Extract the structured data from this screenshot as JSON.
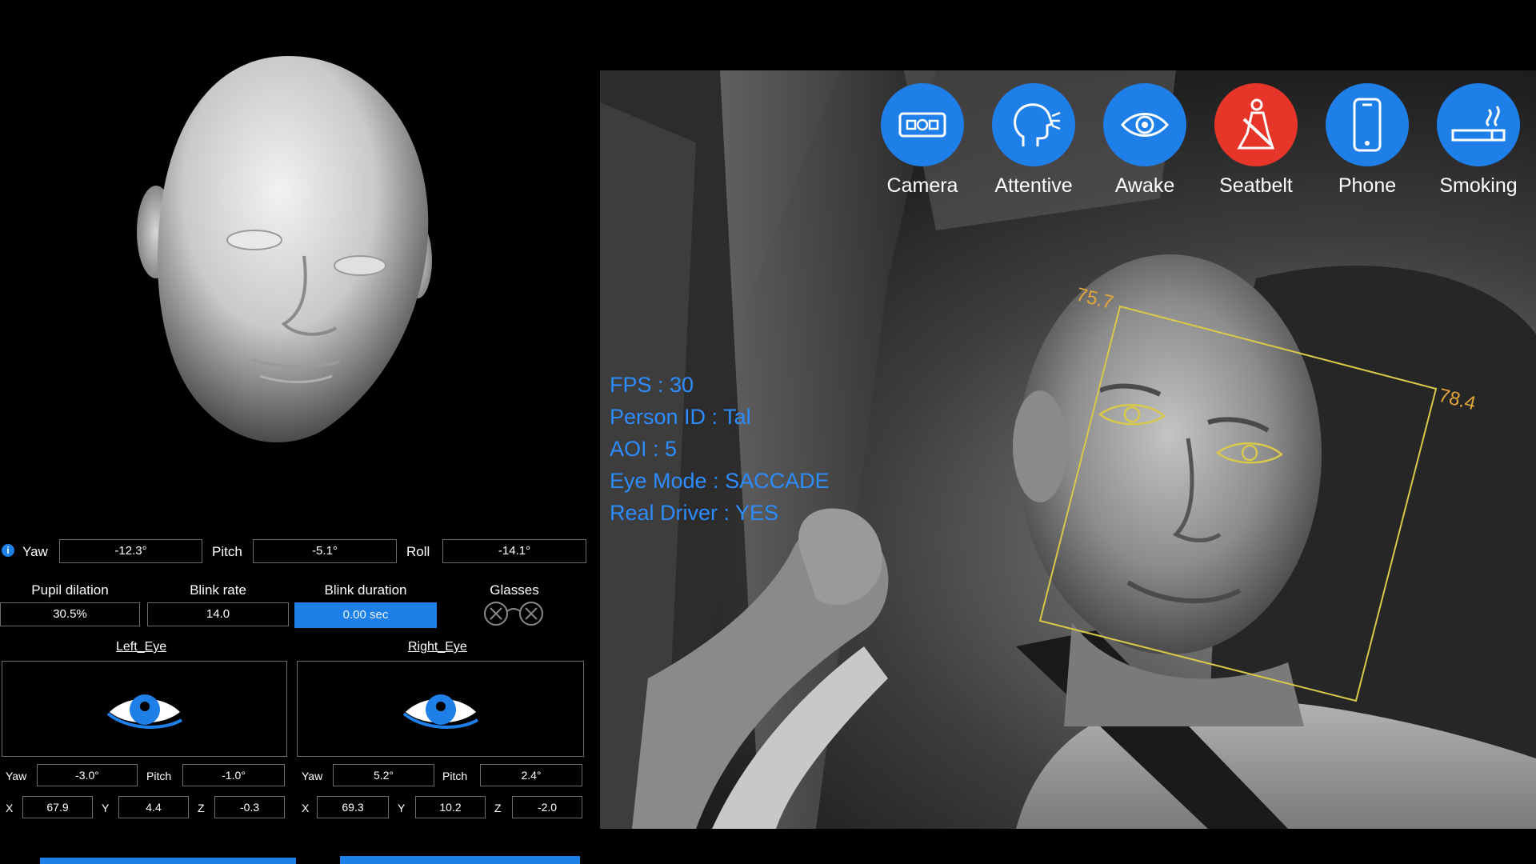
{
  "head_pose": {
    "yaw_label": "Yaw",
    "yaw_value": "-12.3°",
    "pitch_label": "Pitch",
    "pitch_value": "-5.1°",
    "roll_label": "Roll",
    "roll_value": "-14.1°"
  },
  "metrics": {
    "pupil_dilation_label": "Pupil dilation",
    "pupil_dilation_value": "30.5%",
    "blink_rate_label": "Blink rate",
    "blink_rate_value": "14.0",
    "blink_duration_label": "Blink duration",
    "blink_duration_value": "0.00 sec",
    "glasses_label": "Glasses"
  },
  "left_eye": {
    "title": "Left_Eye",
    "yaw_label": "Yaw",
    "yaw_value": "-3.0°",
    "pitch_label": "Pitch",
    "pitch_value": "-1.0°",
    "x_label": "X",
    "x_value": "67.9",
    "y_label": "Y",
    "y_value": "4.4",
    "z_label": "Z",
    "z_value": "-0.3"
  },
  "right_eye": {
    "title": "Right_Eye",
    "yaw_label": "Yaw",
    "yaw_value": "5.2°",
    "pitch_label": "Pitch",
    "pitch_value": "2.4°",
    "x_label": "X",
    "x_value": "69.3",
    "y_label": "Y",
    "y_value": "10.2",
    "z_label": "Z",
    "z_value": "-2.0"
  },
  "status_icons": [
    {
      "label": "Camera",
      "icon": "camera-icon",
      "color": "#1e7fe8"
    },
    {
      "label": "Attentive",
      "icon": "head-attention-icon",
      "color": "#1e7fe8"
    },
    {
      "label": "Awake",
      "icon": "eye-icon",
      "color": "#1e7fe8"
    },
    {
      "label": "Seatbelt",
      "icon": "seatbelt-icon",
      "color": "#e8352a"
    },
    {
      "label": "Phone",
      "icon": "phone-icon",
      "color": "#1e7fe8"
    },
    {
      "label": "Smoking",
      "icon": "cigarette-icon",
      "color": "#1e7fe8"
    }
  ],
  "overlay": {
    "fps": "FPS : 30",
    "person_id": "Person ID : Tal",
    "aoi": "AOI : 5",
    "eye_mode": "Eye Mode : SACCADE",
    "real_driver": "Real Driver : YES"
  },
  "face_box": {
    "angle_left": "75.7",
    "angle_right": "78.4",
    "color": "#d8c94a"
  },
  "colors": {
    "accent_blue": "#1e7fe8",
    "overlay_text": "#2d8cff",
    "alert_red": "#e8352a"
  }
}
